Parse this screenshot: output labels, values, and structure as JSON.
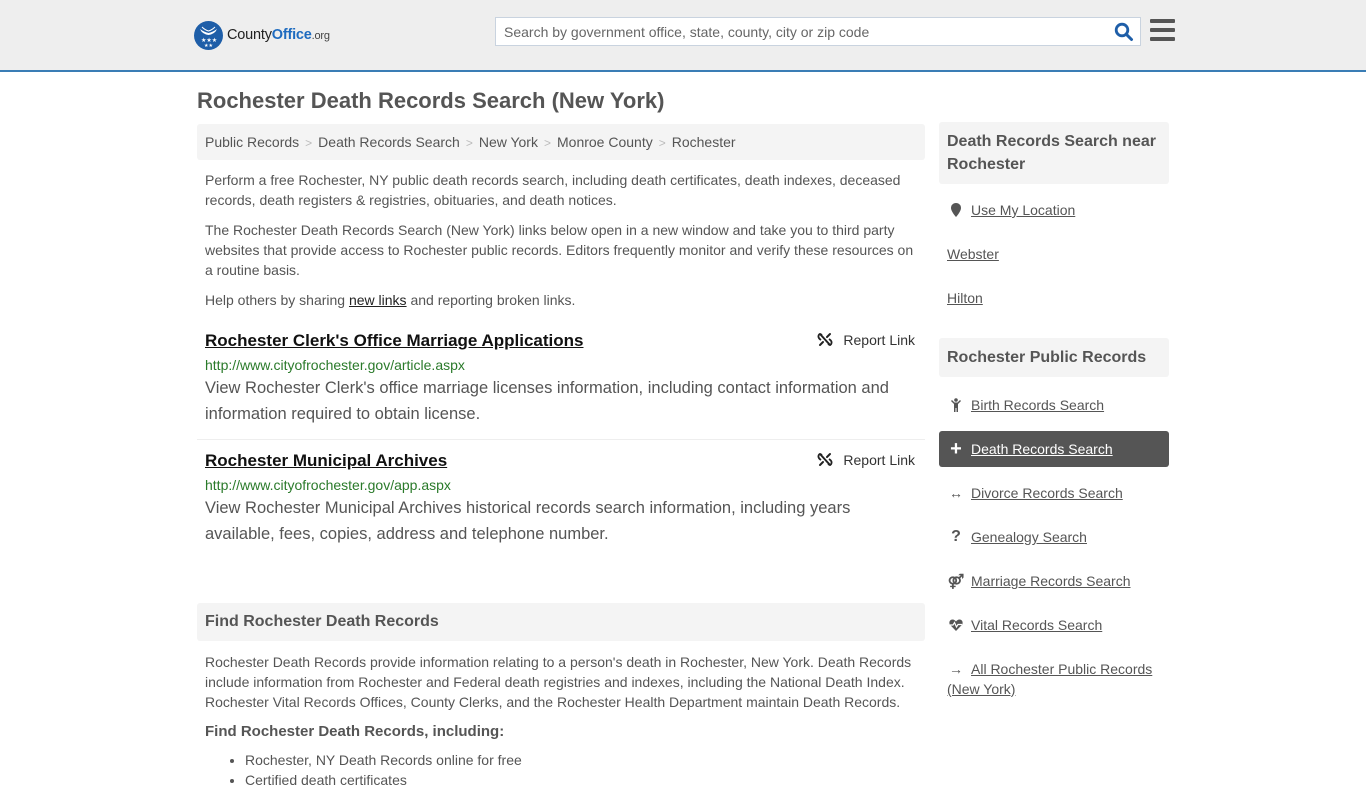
{
  "header": {
    "logo": {
      "brand_part1": "County",
      "brand_part2": "Office",
      "brand_suffix": ".org"
    },
    "search": {
      "placeholder": "Search by government office, state, county, city or zip code",
      "value": ""
    },
    "icons": {
      "search": "search-icon",
      "menu": "hamburger-menu-icon"
    },
    "accent_color": "#3a7db5"
  },
  "page": {
    "title": "Rochester Death Records Search (New York)",
    "breadcrumb": [
      "Public Records",
      "Death Records Search",
      "New York",
      "Monroe County",
      "Rochester"
    ]
  },
  "intro": {
    "p1": "Perform a free Rochester, NY public death records search, including death certificates, death indexes, deceased records, death registers & registries, obituaries, and death notices.",
    "p2": "The Rochester Death Records Search (New York) links below open in a new window and take you to third party websites that provide access to Rochester public records. Editors frequently monitor and verify these resources on a routine basis.",
    "p3_before": "Help others by sharing ",
    "p3_link": "new links",
    "p3_after": " and reporting broken links."
  },
  "links": [
    {
      "title": "Rochester Clerk's Office Marriage Applications",
      "url": "http://www.cityofrochester.gov/article.aspx",
      "description": "View Rochester Clerk's office marriage licenses information, including contact information and information required to obtain license.",
      "report_label": "Report Link"
    },
    {
      "title": "Rochester Municipal Archives",
      "url": "http://www.cityofrochester.gov/app.aspx",
      "description": "View Rochester Municipal Archives historical records search information, including years available, fees, copies, address and telephone number.",
      "report_label": "Report Link"
    }
  ],
  "find_section": {
    "header": "Find Rochester Death Records",
    "paragraph": "Rochester Death Records provide information relating to a person's death in Rochester, New York. Death Records include information from Rochester and Federal death registries and indexes, including the National Death Index. Rochester Vital Records Offices, County Clerks, and the Rochester Health Department maintain Death Records.",
    "subheader": "Find Rochester Death Records, including:",
    "items": [
      "Rochester, NY Death Records online for free",
      "Certified death certificates"
    ]
  },
  "sidebar": {
    "nearby": {
      "header": "Death Records Search near Rochester",
      "use_location": "Use My Location",
      "places": [
        "Webster",
        "Hilton"
      ]
    },
    "public_records": {
      "header": "Rochester Public Records",
      "items": [
        {
          "label": "Birth Records Search",
          "icon": "child-icon",
          "active": false
        },
        {
          "label": "Death Records Search",
          "icon": "plus-icon",
          "active": true
        },
        {
          "label": "Divorce Records Search",
          "icon": "arrows-horizontal-icon",
          "active": false
        },
        {
          "label": "Genealogy Search",
          "icon": "question-icon",
          "active": false
        },
        {
          "label": "Marriage Records Search",
          "icon": "venus-mars-icon",
          "active": false
        },
        {
          "label": "Vital Records Search",
          "icon": "heartbeat-icon",
          "active": false
        },
        {
          "label": "All Rochester Public Records (New York)",
          "icon": "arrow-right-icon",
          "active": false
        }
      ]
    }
  }
}
